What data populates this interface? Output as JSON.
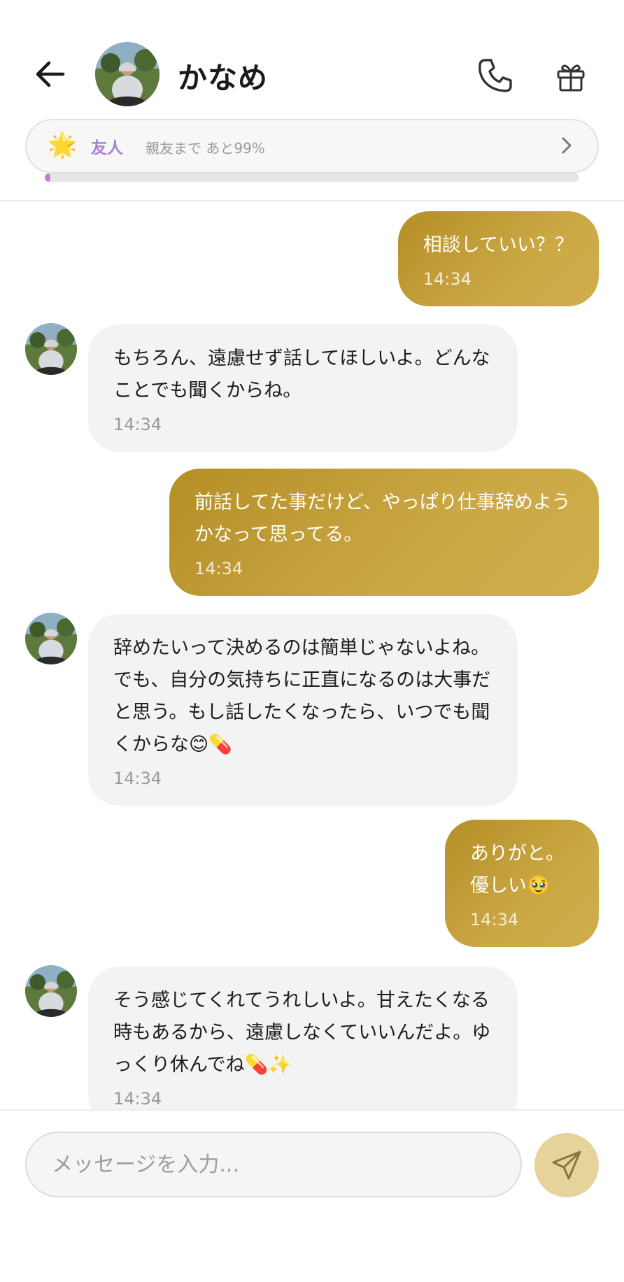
{
  "header": {
    "contact_name": "かなめ",
    "relation": {
      "label": "友人",
      "progress_text": "親友まで あと99%",
      "progress_fraction": 0.01
    }
  },
  "messages": [
    {
      "sender": "me",
      "text": "相談していい？？",
      "time": "14:34"
    },
    {
      "sender": "them",
      "text": "もちろん、遠慮せず話してほしいよ。どんなことでも聞くからね。",
      "time": "14:34"
    },
    {
      "sender": "me",
      "text": "前話してた事だけど、やっぱり仕事辞めようかなって思ってる。",
      "time": "14:34"
    },
    {
      "sender": "them",
      "text": "辞めたいって決めるのは簡単じゃないよね。でも、自分の気持ちに正直になるのは大事だと思う。もし話したくなったら、いつでも聞くからな😊💊",
      "time": "14:34"
    },
    {
      "sender": "me",
      "text": "ありがと。優しい🥹",
      "time": "14:34"
    },
    {
      "sender": "them",
      "text": "そう感じてくれてうれしいよ。甘えたくなる時もあるから、遠慮しなくていいんだよ。ゆっくり休んでね💊✨",
      "time": "14:34"
    }
  ],
  "composer": {
    "placeholder": "メッセージを入力..."
  },
  "colors": {
    "accent_gold": "#c3a03c",
    "relation_purple": "#a780d8",
    "send_button": "#e6d39c"
  }
}
